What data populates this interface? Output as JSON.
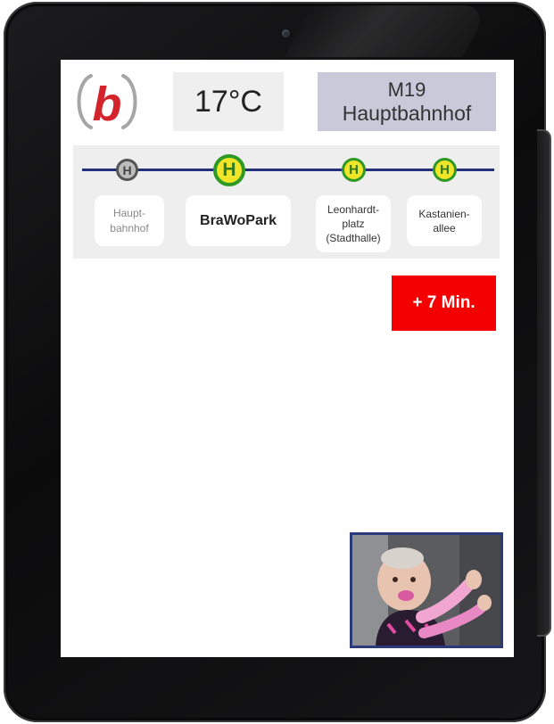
{
  "header": {
    "logo_letter": "b",
    "temperature": "17°C",
    "route_line": "M19",
    "route_destination": "Hauptbahnhof"
  },
  "stops": [
    {
      "symbol": "H",
      "name": "Haupt-\nbahnhof",
      "state": "past"
    },
    {
      "symbol": "H",
      "name": "BraWoPark",
      "state": "current"
    },
    {
      "symbol": "H",
      "name": "Leonhardt-\nplatz\n(Stadthalle)",
      "state": "next"
    },
    {
      "symbol": "H",
      "name": "Kastanien-\nallee",
      "state": "next"
    }
  ],
  "delay": {
    "label": "+ 7 Min."
  },
  "colors": {
    "logo_red": "#d4232a",
    "route_box_bg": "#c9c9d9",
    "track": "#25307a",
    "stop_yellow": "#f1e52a",
    "stop_green": "#2e9a26",
    "delay_red": "#f40000",
    "video_border": "#2a3a7a"
  },
  "video": {
    "icon": "video-feed-baby"
  }
}
